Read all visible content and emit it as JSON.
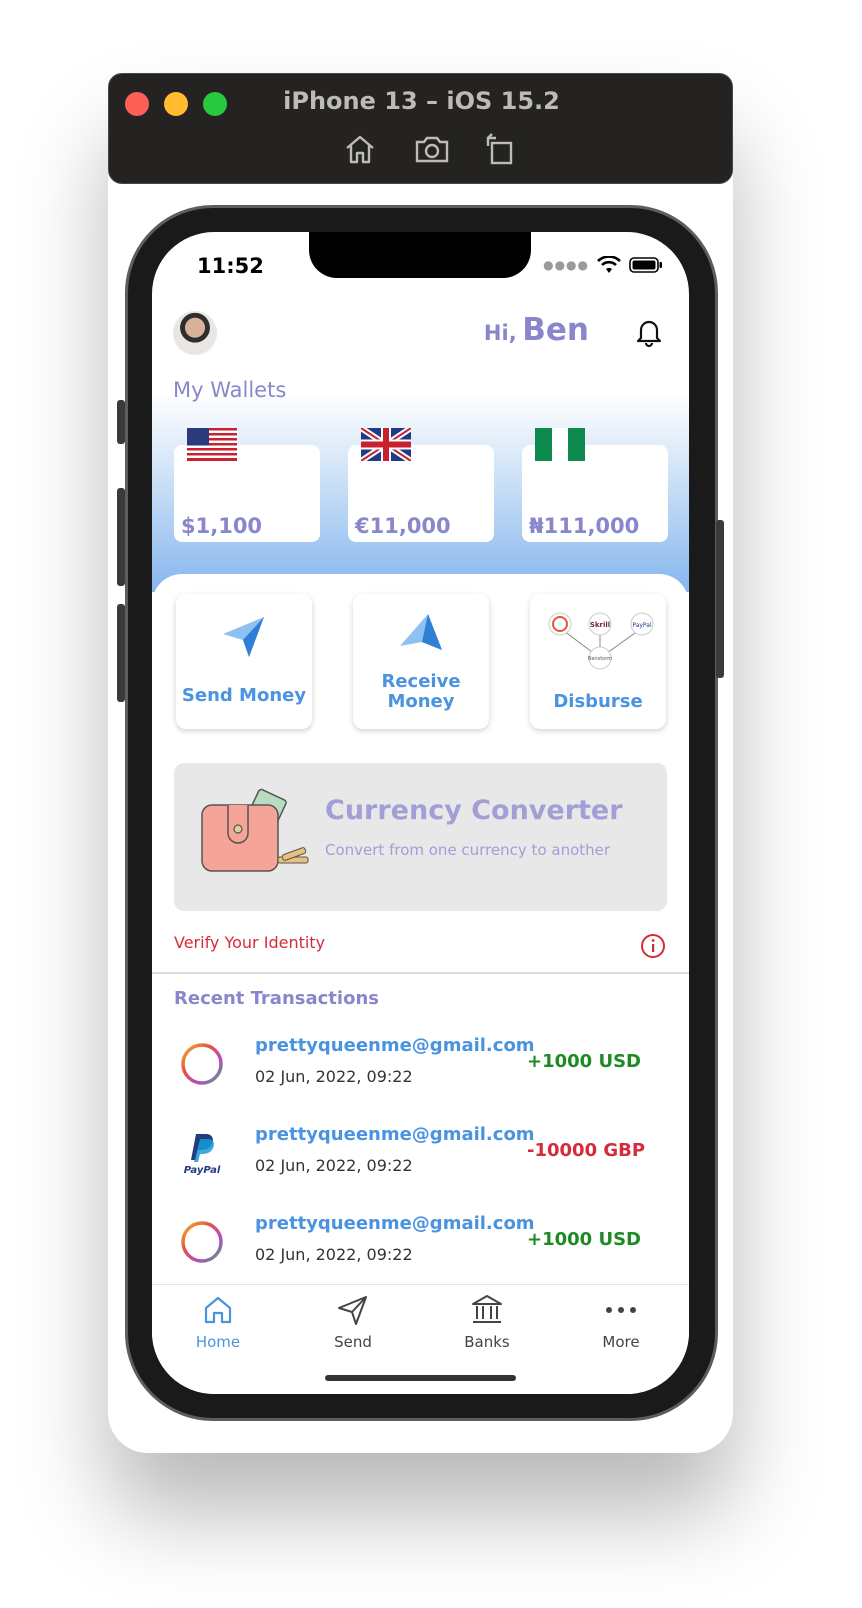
{
  "simulator": {
    "title": "iPhone 13 – iOS 15.2",
    "tools": [
      "home-icon",
      "screenshot-icon",
      "rotate-icon"
    ]
  },
  "status_bar": {
    "time": "11:52"
  },
  "header": {
    "greeting": "Hi,",
    "user_name": "Ben"
  },
  "wallets": {
    "title": "My Wallets",
    "items": [
      {
        "flag": "us-flag",
        "amount": "$1,100"
      },
      {
        "flag": "uk-flag",
        "amount": "€11,000"
      },
      {
        "flag": "nigeria-flag",
        "amount": "₦111,000"
      }
    ]
  },
  "actions": [
    {
      "label": "Send Money",
      "icon": "paper-plane-icon"
    },
    {
      "label": "Receive Money",
      "icon": "paper-plane-icon"
    },
    {
      "label": "Disburse",
      "icon": "disburse-network-icon",
      "network_labels": [
        "Skrill",
        "PayPal",
        "Benstorm"
      ]
    }
  ],
  "converter": {
    "title": "Currency Converter",
    "subtitle": "Convert from one currency to another"
  },
  "verify": {
    "label": "Verify Your Identity"
  },
  "recent": {
    "title": "Recent Transactions",
    "transactions": [
      {
        "icon": "ring-logo-icon",
        "email": "prettyqueenme@gmail.com",
        "date": "02 Jun, 2022, 09:22",
        "amount": "+1000 USD",
        "direction": "in"
      },
      {
        "icon": "paypal-logo-icon",
        "email": "prettyqueenme@gmail.com",
        "date": "02 Jun, 2022, 09:22",
        "amount": "-10000 GBP",
        "direction": "out",
        "logo_text": "PayPal"
      },
      {
        "icon": "ring-logo-icon",
        "email": "prettyqueenme@gmail.com",
        "date": "02 Jun, 2022, 09:22",
        "amount": "+1000 USD",
        "direction": "in"
      }
    ]
  },
  "tabbar": {
    "items": [
      {
        "label": "Home",
        "icon": "home-icon",
        "active": true
      },
      {
        "label": "Send",
        "icon": "send-icon",
        "active": false
      },
      {
        "label": "Banks",
        "icon": "bank-icon",
        "active": false
      },
      {
        "label": "More",
        "icon": "more-icon",
        "active": false
      }
    ]
  },
  "colors": {
    "accent_purple": "#8a86cc",
    "accent_blue": "#4a93e0",
    "positive": "#1f8a24",
    "negative": "#d52b3a"
  }
}
